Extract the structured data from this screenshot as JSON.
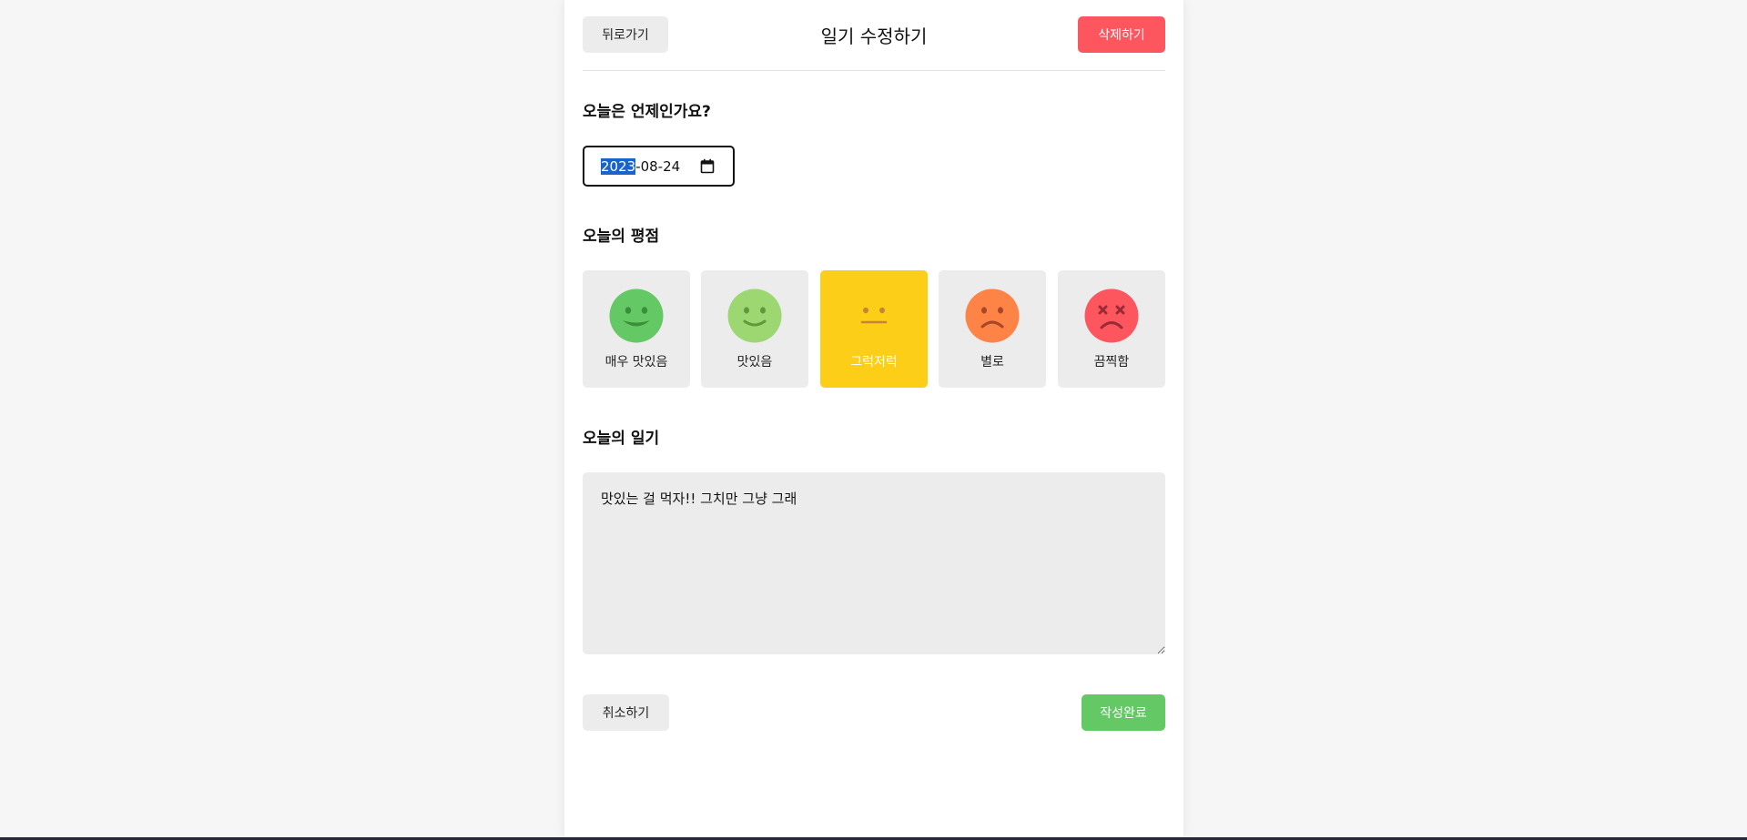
{
  "header": {
    "back_label": "뒤로가기",
    "title": "일기 수정하기",
    "delete_label": "삭제하기"
  },
  "date_section": {
    "title": "오늘은 언제인가요?",
    "date_year": "2023",
    "date_rest": "-08-24"
  },
  "emotion_section": {
    "title": "오늘의 평점",
    "items": [
      {
        "label": "매우 맛있음",
        "color": "#64c964",
        "selected": false
      },
      {
        "label": "맛있음",
        "color": "#9dd772",
        "selected": false
      },
      {
        "label": "그럭저럭",
        "color": "#fdce17",
        "selected": true
      },
      {
        "label": "별로",
        "color": "#fd8446",
        "selected": false
      },
      {
        "label": "끔찍함",
        "color": "#fd565f",
        "selected": false
      }
    ]
  },
  "diary_section": {
    "title": "오늘의 일기",
    "content": "맛있는 걸 먹자!! 그치만 그냥 그래"
  },
  "footer": {
    "cancel_label": "취소하기",
    "done_label": "작성완료"
  }
}
